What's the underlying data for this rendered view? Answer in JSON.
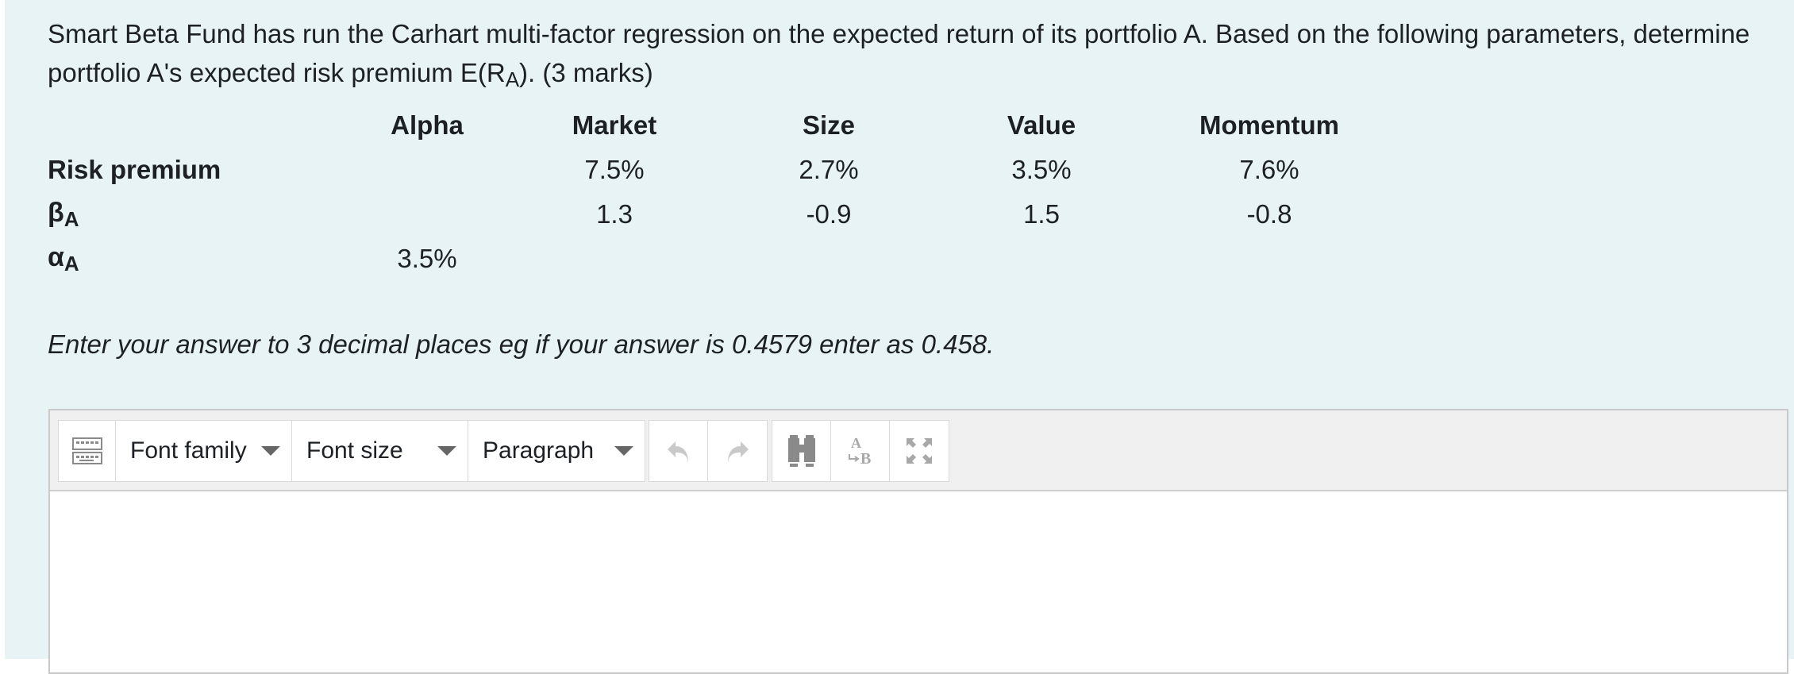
{
  "question": {
    "text_before": "Smart Beta Fund has run the Carhart multi-factor regression on the expected return of its portfolio A.  Based on the following parameters, determine portfolio  A's expected risk premium E(R",
    "subscript": "A",
    "text_after": ").  (3 marks)"
  },
  "table": {
    "headers": [
      "Alpha",
      "Market",
      "Size",
      "Value",
      "Momentum"
    ],
    "rows": [
      {
        "label": "Risk premium",
        "symbol": "",
        "sub": "",
        "values": [
          "",
          "7.5%",
          "2.7%",
          "3.5%",
          "7.6%"
        ]
      },
      {
        "label": "",
        "symbol": "β",
        "sub": "A",
        "values": [
          "",
          "1.3",
          "-0.9",
          "1.5",
          "-0.8"
        ]
      },
      {
        "label": "",
        "symbol": "α",
        "sub": "A",
        "values": [
          "3.5%",
          "",
          "",
          "",
          ""
        ]
      }
    ]
  },
  "instruction": "Enter your answer to 3 decimal places eg if your answer is 0.4579 enter as 0.458.",
  "editor": {
    "toolbar": {
      "toolbar_toggle_icon": "keyboard-icon",
      "font_family": "Font family",
      "font_size": "Font size",
      "paragraph": "Paragraph",
      "icons": [
        "undo-icon",
        "redo-icon",
        "find-icon",
        "find-replace-icon",
        "fullscreen-icon"
      ]
    },
    "content": ""
  }
}
